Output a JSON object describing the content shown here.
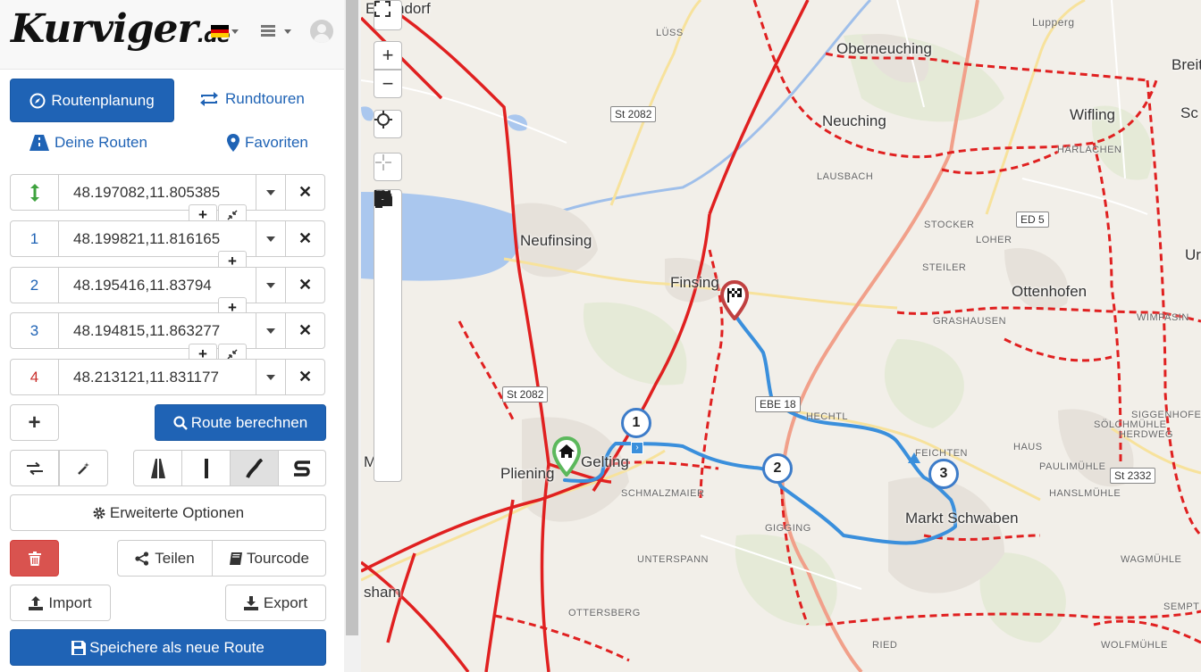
{
  "header": {
    "logo_main": "Kurviger",
    "logo_tld": ".de",
    "flag_colors": [
      "#000000",
      "#dd0000",
      "#ffce00"
    ]
  },
  "tabs": {
    "route_planning": "Routenplanung",
    "round_trips": "Rundtouren",
    "my_routes": "Deine Routen",
    "favorites": "Favoriten"
  },
  "waypoints": [
    {
      "label": "↕",
      "value": "48.197082,11.805385",
      "color": "#3fa33f"
    },
    {
      "label": "1",
      "value": "48.199821,11.816165",
      "color": "#1f63b5"
    },
    {
      "label": "2",
      "value": "48.195416,11.83794",
      "color": "#1f63b5"
    },
    {
      "label": "3",
      "value": "48.194815,11.863277",
      "color": "#1f63b5"
    },
    {
      "label": "4",
      "value": "48.213121,11.831177",
      "color": "#c9302c"
    }
  ],
  "actions": {
    "add": "+",
    "compute_route": "Route berechnen",
    "advanced_options": "Erweiterte Optionen",
    "share": "Teilen",
    "tourcode": "Tourcode",
    "import": "Import",
    "export": "Export",
    "save_new": "Speichere als neue Route"
  },
  "map": {
    "towns": [
      "Eittendorf",
      "Oberneuching",
      "Neuching",
      "Wifling",
      "Neufinsing",
      "Finsing",
      "Ottenhofen",
      "Markt Schwaben",
      "Gelting",
      "Pliening",
      "Lupperg",
      "Breit",
      "Sc",
      "Ur",
      "sham",
      "Ma"
    ],
    "localities": [
      "HARLACHEN",
      "LAUSBACH",
      "STOCKER",
      "LOHER",
      "STEILER",
      "GRASHAUSEN",
      "WIMPASIN",
      "HECHTL",
      "FEICHTEN",
      "HAUS",
      "SÖLCHMÜHLE",
      "SIGGENHOFEN",
      "HERDWEG",
      "PAULIMÜHLE",
      "HANSLMÜHLE",
      "SCHMALZMAIER",
      "GIGGING",
      "UNTERSPANN",
      "OTTERSBERG",
      "RIED",
      "WAGMÜHLE",
      "SEMPT",
      "WOLFMÜHLE",
      "LÜSS"
    ],
    "road_shields": [
      "St 2082",
      "St 2082",
      "ED 5",
      "EBE 18",
      "St 2332"
    ],
    "route_color": "#3a8fdc",
    "track_color": "#e02020"
  }
}
